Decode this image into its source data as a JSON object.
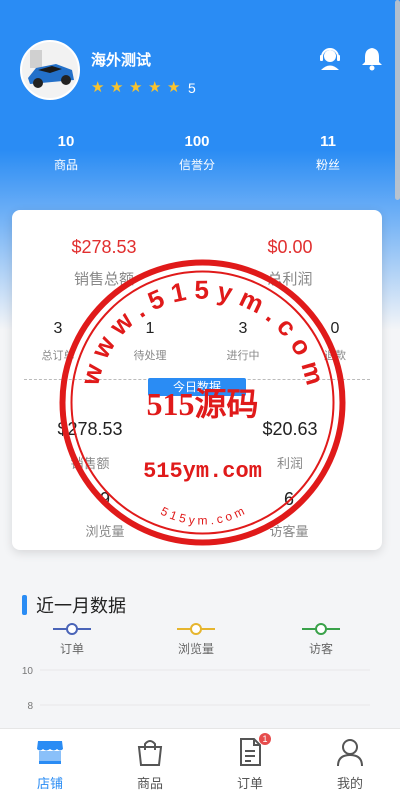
{
  "store": {
    "name": "海外测试",
    "stars": 5,
    "rating": "5"
  },
  "stats": [
    {
      "value": "10",
      "label": "商品"
    },
    {
      "value": "100",
      "label": "信誉分"
    },
    {
      "value": "11",
      "label": "粉丝"
    }
  ],
  "summary": {
    "sales_total": {
      "value": "$278.53",
      "label": "销售总额"
    },
    "profit_total": {
      "value": "$0.00",
      "label": "总利润"
    },
    "orders": [
      {
        "value": "3",
        "label": "总订单"
      },
      {
        "value": "1",
        "label": "待处理"
      },
      {
        "value": "3",
        "label": "进行中"
      },
      {
        "value": "0",
        "label": "退款"
      }
    ],
    "today_label": "今日数据",
    "today": [
      {
        "value": "$278.53",
        "label": "销售额"
      },
      {
        "value": "$20.63",
        "label": "利润"
      },
      {
        "value": "9",
        "label": "浏览量"
      },
      {
        "value": "6",
        "label": "访客量"
      }
    ]
  },
  "watermark": {
    "domain": "w w w . 5 1 5 y m . c o m",
    "title": "515源码",
    "url": "515ym.com",
    "small": "5 1 5 y m . c o m",
    "color": "#e01a1a"
  },
  "monthly": {
    "title": "近一月数据",
    "legend": [
      {
        "label": "订单",
        "color": "#4a64b8"
      },
      {
        "label": "浏览量",
        "color": "#e6b52e"
      },
      {
        "label": "访客",
        "color": "#3aa24a"
      }
    ],
    "y_ticks": [
      "10",
      "8"
    ]
  },
  "tabbar": {
    "items": [
      {
        "label": "店铺",
        "icon": "store-icon",
        "active": true
      },
      {
        "label": "商品",
        "icon": "bag-icon",
        "active": false
      },
      {
        "label": "订单",
        "icon": "order-icon",
        "active": false
      },
      {
        "label": "我的",
        "icon": "user-icon",
        "active": false
      }
    ],
    "badge": "1"
  },
  "colors": {
    "primary": "#2a8cf4",
    "money": "#e12f2f",
    "star": "#f7c32e"
  }
}
